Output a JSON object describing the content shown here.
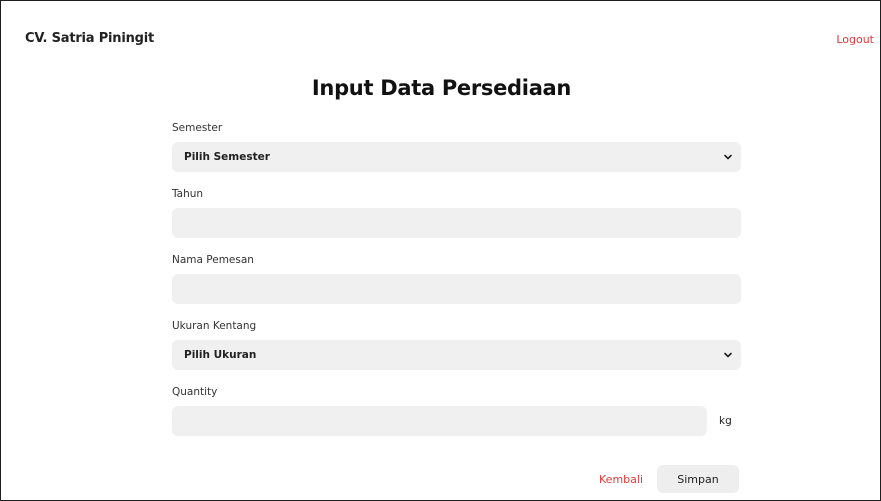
{
  "header": {
    "brand": "CV. Satria Piningit",
    "logout_label": "Logout"
  },
  "page": {
    "title": "Input Data Persediaan"
  },
  "form": {
    "semester": {
      "label": "Semester",
      "selected": "Pilih Semester"
    },
    "tahun": {
      "label": "Tahun",
      "value": ""
    },
    "nama_pemesan": {
      "label": "Nama Pemesan",
      "value": ""
    },
    "ukuran_kentang": {
      "label": "Ukuran Kentang",
      "selected": "Pilih Ukuran"
    },
    "quantity": {
      "label": "Quantity",
      "value": "",
      "unit": "kg"
    }
  },
  "actions": {
    "back_label": "Kembali",
    "save_label": "Simpan"
  },
  "colors": {
    "accent_red": "#d63d3d",
    "field_bg": "#f0f0f0"
  },
  "icons": {
    "dropdown": "chevron-down-icon"
  }
}
